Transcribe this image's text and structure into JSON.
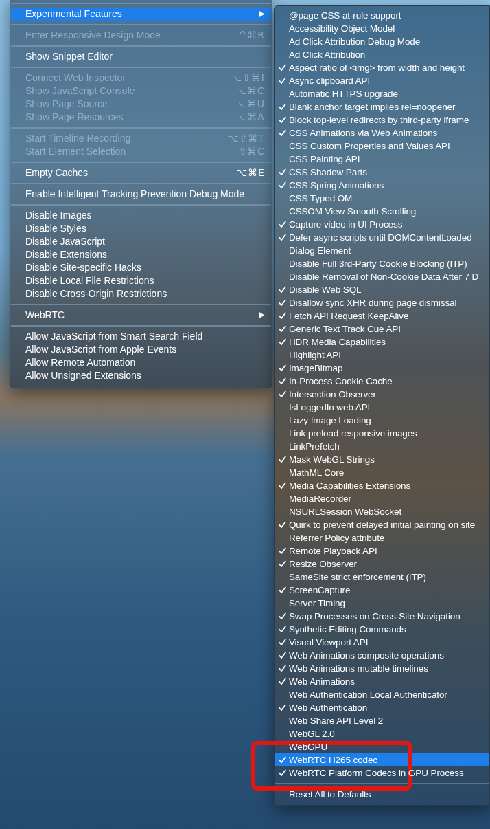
{
  "develop_menu": {
    "items": [
      {
        "kind": "separator"
      },
      {
        "kind": "item",
        "label": "Experimental Features",
        "submenu": true,
        "selected": true,
        "disabled": false
      },
      {
        "kind": "separator"
      },
      {
        "kind": "item",
        "label": "Enter Responsive Design Mode",
        "shortcut": "^⌘R",
        "submenu": false,
        "selected": false,
        "disabled": true
      },
      {
        "kind": "separator"
      },
      {
        "kind": "item",
        "label": "Show Snippet Editor",
        "submenu": false,
        "selected": false,
        "disabled": false
      },
      {
        "kind": "separator"
      },
      {
        "kind": "item",
        "label": "Connect Web Inspector",
        "shortcut": "⌥⇧⌘I",
        "submenu": false,
        "selected": false,
        "disabled": true
      },
      {
        "kind": "item",
        "label": "Show JavaScript Console",
        "shortcut": "⌥⌘C",
        "submenu": false,
        "selected": false,
        "disabled": true
      },
      {
        "kind": "item",
        "label": "Show Page Source",
        "shortcut": "⌥⌘U",
        "submenu": false,
        "selected": false,
        "disabled": true
      },
      {
        "kind": "item",
        "label": "Show Page Resources",
        "shortcut": "⌥⌘A",
        "submenu": false,
        "selected": false,
        "disabled": true
      },
      {
        "kind": "separator"
      },
      {
        "kind": "item",
        "label": "Start Timeline Recording",
        "shortcut": "⌥⇧⌘T",
        "submenu": false,
        "selected": false,
        "disabled": true
      },
      {
        "kind": "item",
        "label": "Start Element Selection",
        "shortcut": "⇧⌘C",
        "submenu": false,
        "selected": false,
        "disabled": true
      },
      {
        "kind": "separator"
      },
      {
        "kind": "item",
        "label": "Empty Caches",
        "shortcut": "⌥⌘E",
        "submenu": false,
        "selected": false,
        "disabled": false
      },
      {
        "kind": "separator"
      },
      {
        "kind": "item",
        "label": "Enable Intelligent Tracking Prevention Debug Mode",
        "submenu": false,
        "selected": false,
        "disabled": false
      },
      {
        "kind": "separator"
      },
      {
        "kind": "item",
        "label": "Disable Images",
        "submenu": false,
        "selected": false,
        "disabled": false
      },
      {
        "kind": "item",
        "label": "Disable Styles",
        "submenu": false,
        "selected": false,
        "disabled": false
      },
      {
        "kind": "item",
        "label": "Disable JavaScript",
        "submenu": false,
        "selected": false,
        "disabled": false
      },
      {
        "kind": "item",
        "label": "Disable Extensions",
        "submenu": false,
        "selected": false,
        "disabled": false
      },
      {
        "kind": "item",
        "label": "Disable Site-specific Hacks",
        "submenu": false,
        "selected": false,
        "disabled": false
      },
      {
        "kind": "item",
        "label": "Disable Local File Restrictions",
        "submenu": false,
        "selected": false,
        "disabled": false
      },
      {
        "kind": "item",
        "label": "Disable Cross-Origin Restrictions",
        "submenu": false,
        "selected": false,
        "disabled": false
      },
      {
        "kind": "separator"
      },
      {
        "kind": "item",
        "label": "WebRTC",
        "submenu": true,
        "selected": false,
        "disabled": false
      },
      {
        "kind": "separator"
      },
      {
        "kind": "item",
        "label": "Allow JavaScript from Smart Search Field",
        "submenu": false,
        "selected": false,
        "disabled": false
      },
      {
        "kind": "item",
        "label": "Allow JavaScript from Apple Events",
        "submenu": false,
        "selected": false,
        "disabled": false
      },
      {
        "kind": "item",
        "label": "Allow Remote Automation",
        "submenu": false,
        "selected": false,
        "disabled": false
      },
      {
        "kind": "item",
        "label": "Allow Unsigned Extensions",
        "submenu": false,
        "selected": false,
        "disabled": false
      }
    ]
  },
  "experimental_features_menu": {
    "items": [
      {
        "kind": "item",
        "label": "@page CSS at-rule support",
        "checked": false,
        "selected": false
      },
      {
        "kind": "item",
        "label": "Accessibility Object Model",
        "checked": false,
        "selected": false
      },
      {
        "kind": "item",
        "label": "Ad Click Attribution Debug Mode",
        "checked": false,
        "selected": false
      },
      {
        "kind": "item",
        "label": "Ad Click Attribution",
        "checked": false,
        "selected": false
      },
      {
        "kind": "item",
        "label": "Aspect ratio of <img> from width and height",
        "checked": true,
        "selected": false
      },
      {
        "kind": "item",
        "label": "Async clipboard API",
        "checked": true,
        "selected": false
      },
      {
        "kind": "item",
        "label": "Automatic HTTPS upgrade",
        "checked": false,
        "selected": false
      },
      {
        "kind": "item",
        "label": "Blank anchor target implies rel=noopener",
        "checked": true,
        "selected": false
      },
      {
        "kind": "item",
        "label": "Block top-level redirects by third-party iframe",
        "checked": true,
        "selected": false
      },
      {
        "kind": "item",
        "label": "CSS Animations via Web Animations",
        "checked": true,
        "selected": false
      },
      {
        "kind": "item",
        "label": "CSS Custom Properties and Values API",
        "checked": false,
        "selected": false
      },
      {
        "kind": "item",
        "label": "CSS Painting API",
        "checked": false,
        "selected": false
      },
      {
        "kind": "item",
        "label": "CSS Shadow Parts",
        "checked": true,
        "selected": false
      },
      {
        "kind": "item",
        "label": "CSS Spring Animations",
        "checked": true,
        "selected": false
      },
      {
        "kind": "item",
        "label": "CSS Typed OM",
        "checked": false,
        "selected": false
      },
      {
        "kind": "item",
        "label": "CSSOM View Smooth Scrolling",
        "checked": false,
        "selected": false
      },
      {
        "kind": "item",
        "label": "Capture video in UI Process",
        "checked": true,
        "selected": false
      },
      {
        "kind": "item",
        "label": "Defer async scripts until DOMContentLoaded",
        "checked": true,
        "selected": false
      },
      {
        "kind": "item",
        "label": "Dialog Element",
        "checked": false,
        "selected": false
      },
      {
        "kind": "item",
        "label": "Disable Full 3rd-Party Cookie Blocking (ITP)",
        "checked": false,
        "selected": false
      },
      {
        "kind": "item",
        "label": "Disable Removal of Non-Cookie Data After 7 D",
        "checked": false,
        "selected": false
      },
      {
        "kind": "item",
        "label": "Disable Web SQL",
        "checked": true,
        "selected": false
      },
      {
        "kind": "item",
        "label": "Disallow sync XHR during page dismissal",
        "checked": true,
        "selected": false
      },
      {
        "kind": "item",
        "label": "Fetch API Request KeepAlive",
        "checked": true,
        "selected": false
      },
      {
        "kind": "item",
        "label": "Generic Text Track Cue API",
        "checked": true,
        "selected": false
      },
      {
        "kind": "item",
        "label": "HDR Media Capabilities",
        "checked": true,
        "selected": false
      },
      {
        "kind": "item",
        "label": "Highlight API",
        "checked": false,
        "selected": false
      },
      {
        "kind": "item",
        "label": "ImageBitmap",
        "checked": true,
        "selected": false
      },
      {
        "kind": "item",
        "label": "In-Process Cookie Cache",
        "checked": true,
        "selected": false
      },
      {
        "kind": "item",
        "label": "Intersection Observer",
        "checked": true,
        "selected": false
      },
      {
        "kind": "item",
        "label": "IsLoggedIn web API",
        "checked": false,
        "selected": false
      },
      {
        "kind": "item",
        "label": "Lazy Image Loading",
        "checked": false,
        "selected": false
      },
      {
        "kind": "item",
        "label": "Link preload responsive images",
        "checked": false,
        "selected": false
      },
      {
        "kind": "item",
        "label": "LinkPrefetch",
        "checked": false,
        "selected": false
      },
      {
        "kind": "item",
        "label": "Mask WebGL Strings",
        "checked": true,
        "selected": false
      },
      {
        "kind": "item",
        "label": "MathML Core",
        "checked": false,
        "selected": false
      },
      {
        "kind": "item",
        "label": "Media Capabilities Extensions",
        "checked": true,
        "selected": false
      },
      {
        "kind": "item",
        "label": "MediaRecorder",
        "checked": false,
        "selected": false
      },
      {
        "kind": "item",
        "label": "NSURLSession WebSocket",
        "checked": false,
        "selected": false
      },
      {
        "kind": "item",
        "label": "Quirk to prevent delayed initial painting on site",
        "checked": true,
        "selected": false
      },
      {
        "kind": "item",
        "label": "Referrer Policy attribute",
        "checked": false,
        "selected": false
      },
      {
        "kind": "item",
        "label": "Remote Playback API",
        "checked": true,
        "selected": false
      },
      {
        "kind": "item",
        "label": "Resize Observer",
        "checked": true,
        "selected": false
      },
      {
        "kind": "item",
        "label": "SameSite strict enforcement (ITP)",
        "checked": false,
        "selected": false
      },
      {
        "kind": "item",
        "label": "ScreenCapture",
        "checked": true,
        "selected": false
      },
      {
        "kind": "item",
        "label": "Server Timing",
        "checked": false,
        "selected": false
      },
      {
        "kind": "item",
        "label": "Swap Processes on Cross-Site Navigation",
        "checked": true,
        "selected": false
      },
      {
        "kind": "item",
        "label": "Synthetic Editing Commands",
        "checked": true,
        "selected": false
      },
      {
        "kind": "item",
        "label": "Visual Viewport API",
        "checked": true,
        "selected": false
      },
      {
        "kind": "item",
        "label": "Web Animations composite operations",
        "checked": true,
        "selected": false
      },
      {
        "kind": "item",
        "label": "Web Animations mutable timelines",
        "checked": true,
        "selected": false
      },
      {
        "kind": "item",
        "label": "Web Animations",
        "checked": true,
        "selected": false
      },
      {
        "kind": "item",
        "label": "Web Authentication Local Authenticator",
        "checked": false,
        "selected": false
      },
      {
        "kind": "item",
        "label": "Web Authentication",
        "checked": true,
        "selected": false
      },
      {
        "kind": "item",
        "label": "Web Share API Level 2",
        "checked": false,
        "selected": false
      },
      {
        "kind": "item",
        "label": "WebGL 2.0",
        "checked": false,
        "selected": false
      },
      {
        "kind": "item",
        "label": "WebGPU",
        "checked": false,
        "selected": false
      },
      {
        "kind": "item",
        "label": "WebRTC H265 codec",
        "checked": true,
        "selected": true
      },
      {
        "kind": "item",
        "label": "WebRTC Platform Codecs in GPU Process",
        "checked": true,
        "selected": false
      },
      {
        "kind": "separator"
      },
      {
        "kind": "item",
        "label": "Reset All to Defaults",
        "checked": false,
        "selected": false
      }
    ]
  }
}
